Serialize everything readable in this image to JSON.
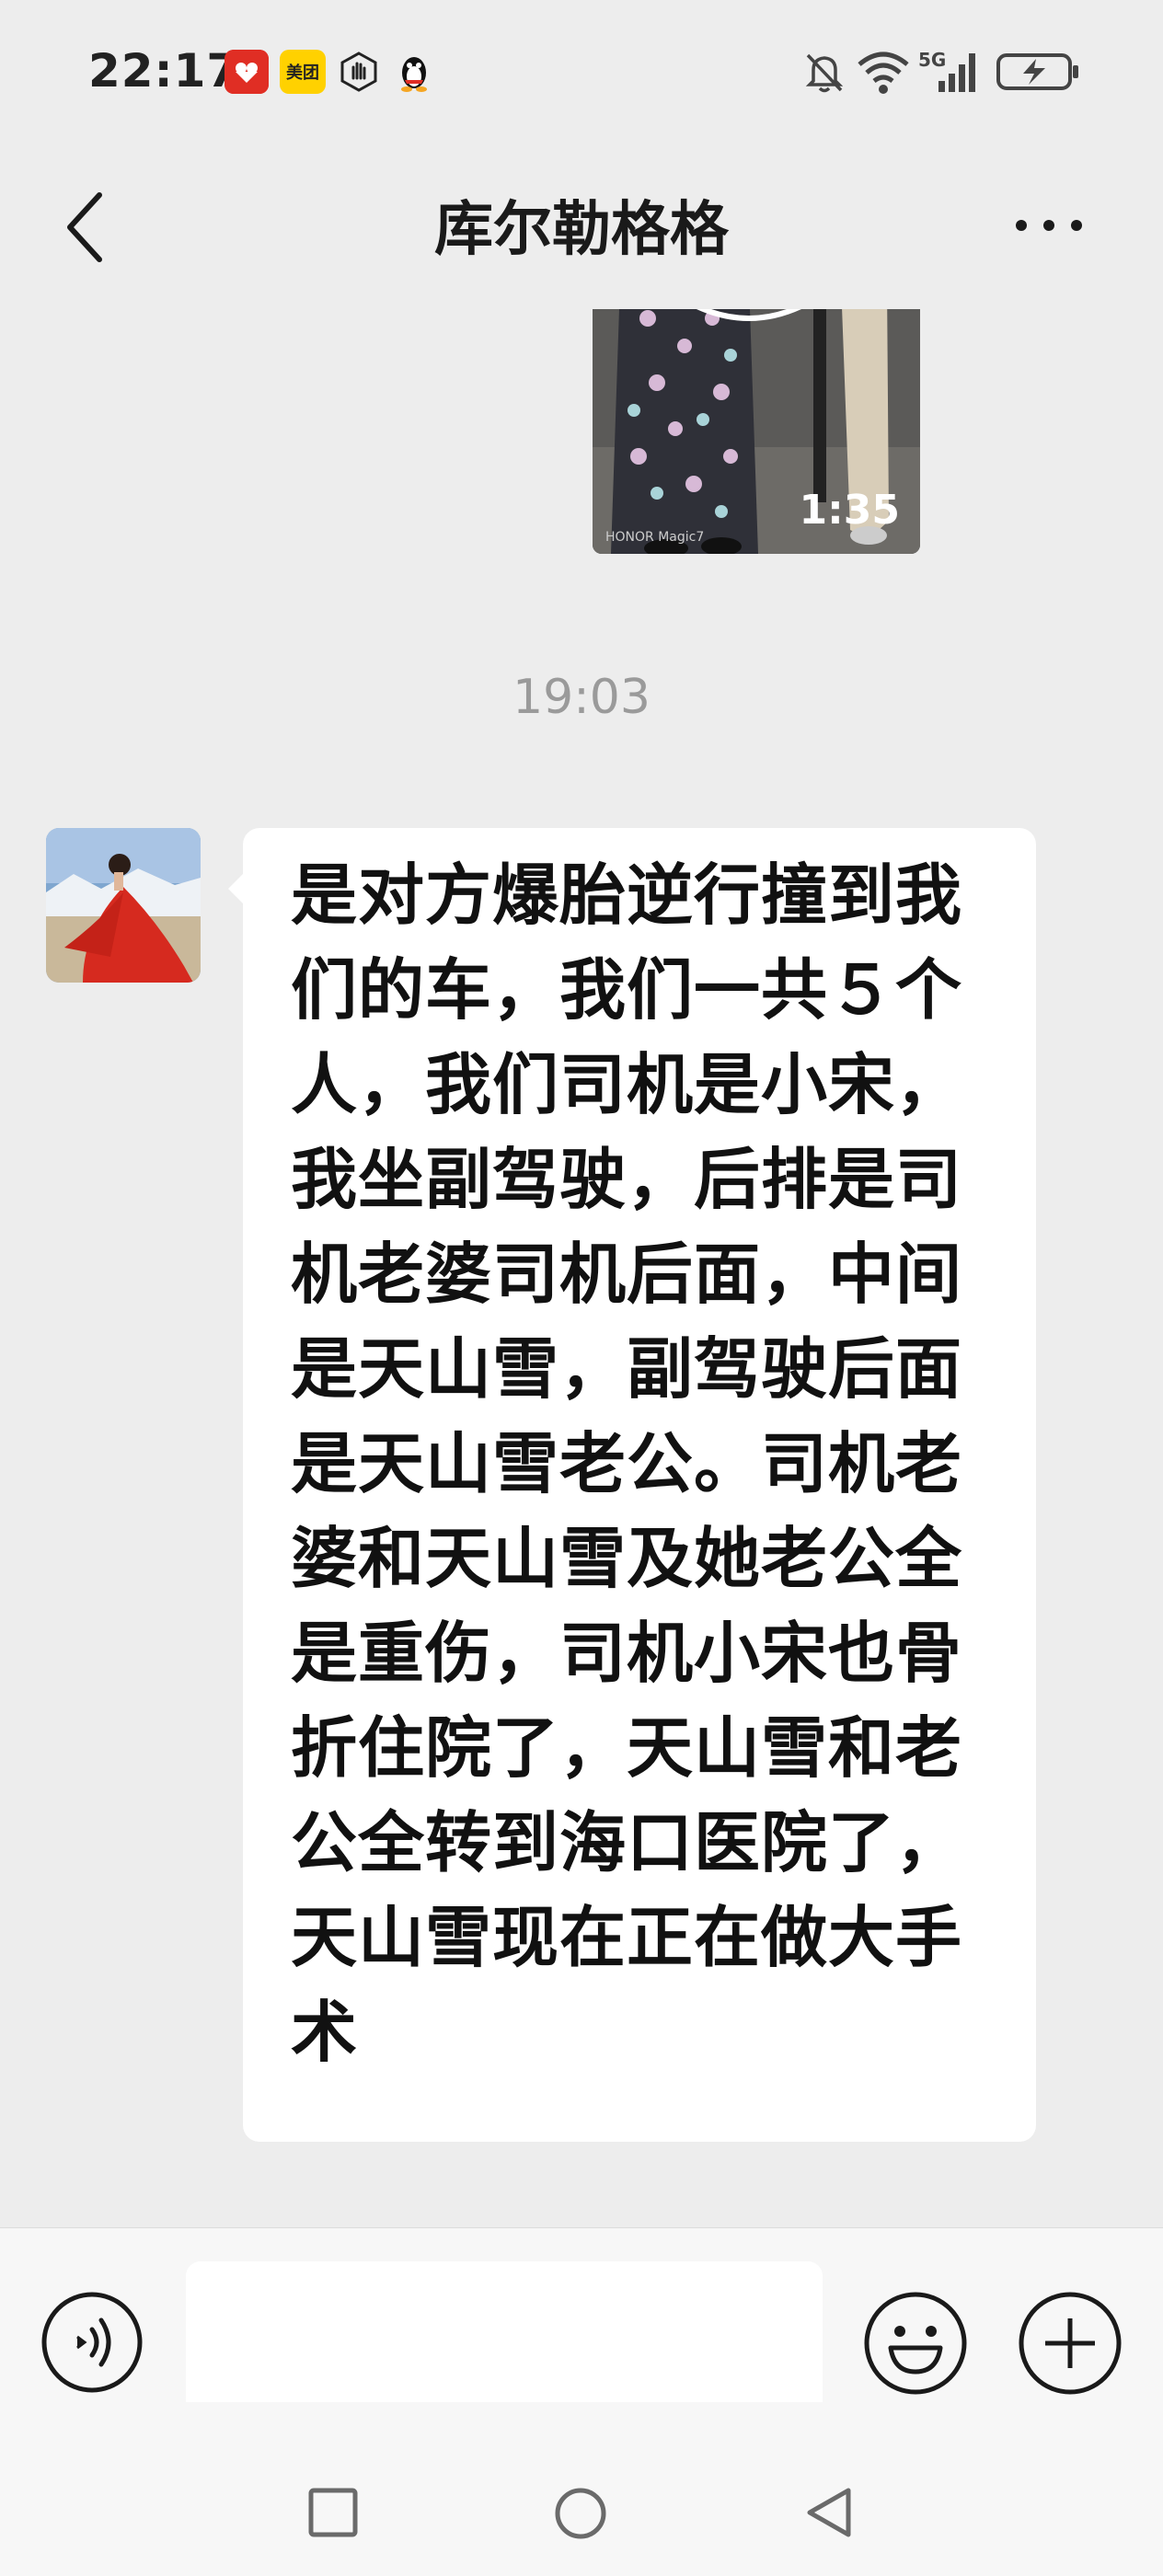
{
  "status_bar": {
    "time": "22:17",
    "notifications": [
      {
        "name": "pinduoduo-icon",
        "label": "11.11"
      },
      {
        "name": "meituan-icon",
        "label": "美团"
      },
      {
        "name": "hand-icon"
      },
      {
        "name": "qq-penguin-icon"
      }
    ],
    "system": {
      "mute_icon": "bell-off-icon",
      "wifi_icon": "wifi-icon",
      "network_label": "5G",
      "battery_icon": "battery-charging-icon"
    }
  },
  "header": {
    "title": "库尔勒格格",
    "back_icon": "chevron-left-icon",
    "more_icon": "more-dots-icon"
  },
  "chat": {
    "video_message": {
      "duration": "1:35",
      "watermark": "HONOR Magic7"
    },
    "timestamp": "19:03",
    "message": {
      "lines": [
        "是对方爆胎逆行撞到我",
        "们的车，我们一共５个",
        "人，我们司机是小宋，",
        "我坐副驾驶，后排是司",
        "机老婆司机后面，中间",
        "是天山雪，副驾驶后面",
        "是天山雪老公。司机老",
        "婆和天山雪及她老公全",
        "是重伤，司机小宋也骨",
        "折住院了，天山雪和老",
        "公全转到海口医院了，",
        "天山雪现在正在做大手",
        "术"
      ]
    }
  },
  "input_bar": {
    "voice_icon": "voice-icon",
    "text_value": "",
    "emoji_icon": "emoji-icon",
    "plus_icon": "plus-circle-icon"
  },
  "nav_bar": {
    "recent_icon": "square-icon",
    "home_icon": "circle-icon",
    "back_icon": "triangle-back-icon"
  },
  "colors": {
    "background": "#ededed",
    "bubble": "#ffffff",
    "timestamp": "#9a9a9a",
    "avatar_red": "#d62a1f"
  }
}
